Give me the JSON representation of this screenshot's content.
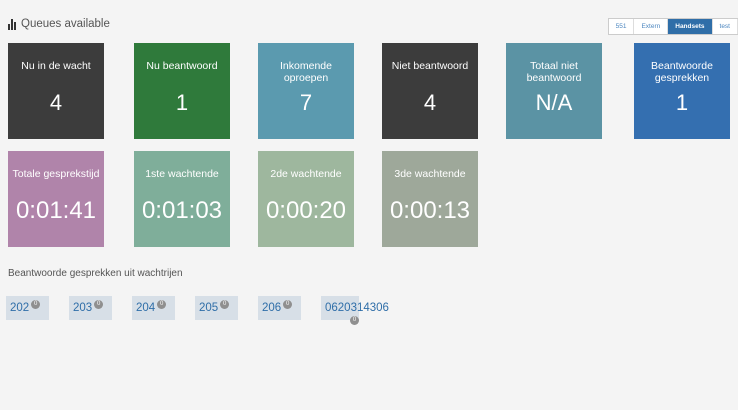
{
  "header": {
    "title": "Queues available"
  },
  "tabs": [
    {
      "label": "551",
      "active": false
    },
    {
      "label": "Extern",
      "active": false
    },
    {
      "label": "Handsets",
      "active": true
    },
    {
      "label": "test",
      "active": false
    }
  ],
  "tiles": {
    "waiting": {
      "label": "Nu in de wacht",
      "value": "4",
      "color": "#3c3c3c"
    },
    "answering": {
      "label": "Nu beantwoord",
      "value": "1",
      "color": "#2f7a3b"
    },
    "incoming": {
      "label": "Inkomende oproepen",
      "value": "7",
      "color": "#5b9aaf"
    },
    "not_answered": {
      "label": "Niet beantwoord",
      "value": "4",
      "color": "#3c3c3c"
    },
    "total_unanswered": {
      "label": "Totaal niet beantwoord",
      "value": "N/A",
      "color": "#5b93a4"
    },
    "answered_calls": {
      "label": "Beantwoorde gesprekken",
      "value": "1",
      "color": "#346fb0"
    },
    "total_talk_time": {
      "label": "Totale gesprekstijd",
      "value": "0:01:41",
      "color": "#b084aa"
    },
    "first_waiting": {
      "label": "1ste wachtende",
      "value": "0:01:03",
      "color": "#7fae9a"
    },
    "second_waiting": {
      "label": "2de wachtende",
      "value": "0:00:20",
      "color": "#9eb79e"
    },
    "third_waiting": {
      "label": "3de wachtende",
      "value": "0:00:13",
      "color": "#9ea89a"
    }
  },
  "answered_section": {
    "title": "Beantwoorde gesprekken uit wachtrijen"
  },
  "queues": [
    {
      "label": "202",
      "count": "0"
    },
    {
      "label": "203",
      "count": "0"
    },
    {
      "label": "204",
      "count": "0"
    },
    {
      "label": "205",
      "count": "0"
    },
    {
      "label": "206",
      "count": "0"
    },
    {
      "label": "0620314306",
      "count": "0"
    }
  ]
}
